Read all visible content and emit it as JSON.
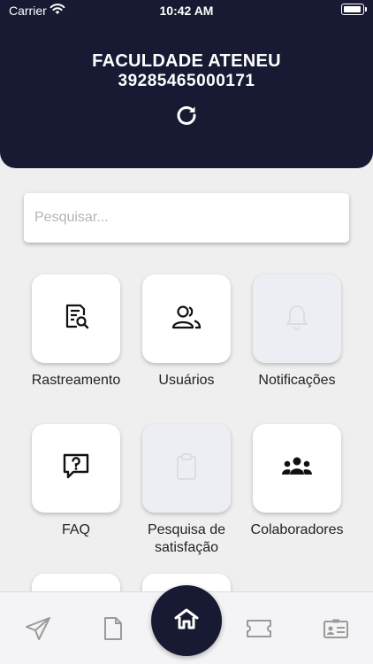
{
  "status_bar": {
    "carrier": "Carrier",
    "time": "10:42 AM"
  },
  "header": {
    "org_name": "FACULDADE ATENEU",
    "org_id": "39285465000171"
  },
  "search": {
    "placeholder": "Pesquisar..."
  },
  "menu": {
    "items": [
      {
        "label": "Rastreamento",
        "icon": "document-search-icon",
        "enabled": true
      },
      {
        "label": "Usuários",
        "icon": "users-icon",
        "enabled": true
      },
      {
        "label": "Notificações",
        "icon": "bell-icon",
        "enabled": false
      },
      {
        "label": "FAQ",
        "icon": "question-chat-icon",
        "enabled": true
      },
      {
        "label": "Pesquisa de satisfação",
        "icon": "clipboard-icon",
        "enabled": false
      },
      {
        "label": "Colaboradores",
        "icon": "team-icon",
        "enabled": true
      }
    ]
  },
  "bottom_nav": {
    "items": [
      "send-icon",
      "document-icon",
      "home-icon",
      "ticket-icon",
      "id-card-icon"
    ],
    "active": "home-icon"
  },
  "colors": {
    "primary": "#181a33",
    "background": "#efefef",
    "disabled_tile": "#eceef3",
    "nav_icon": "#9a9a9a"
  }
}
